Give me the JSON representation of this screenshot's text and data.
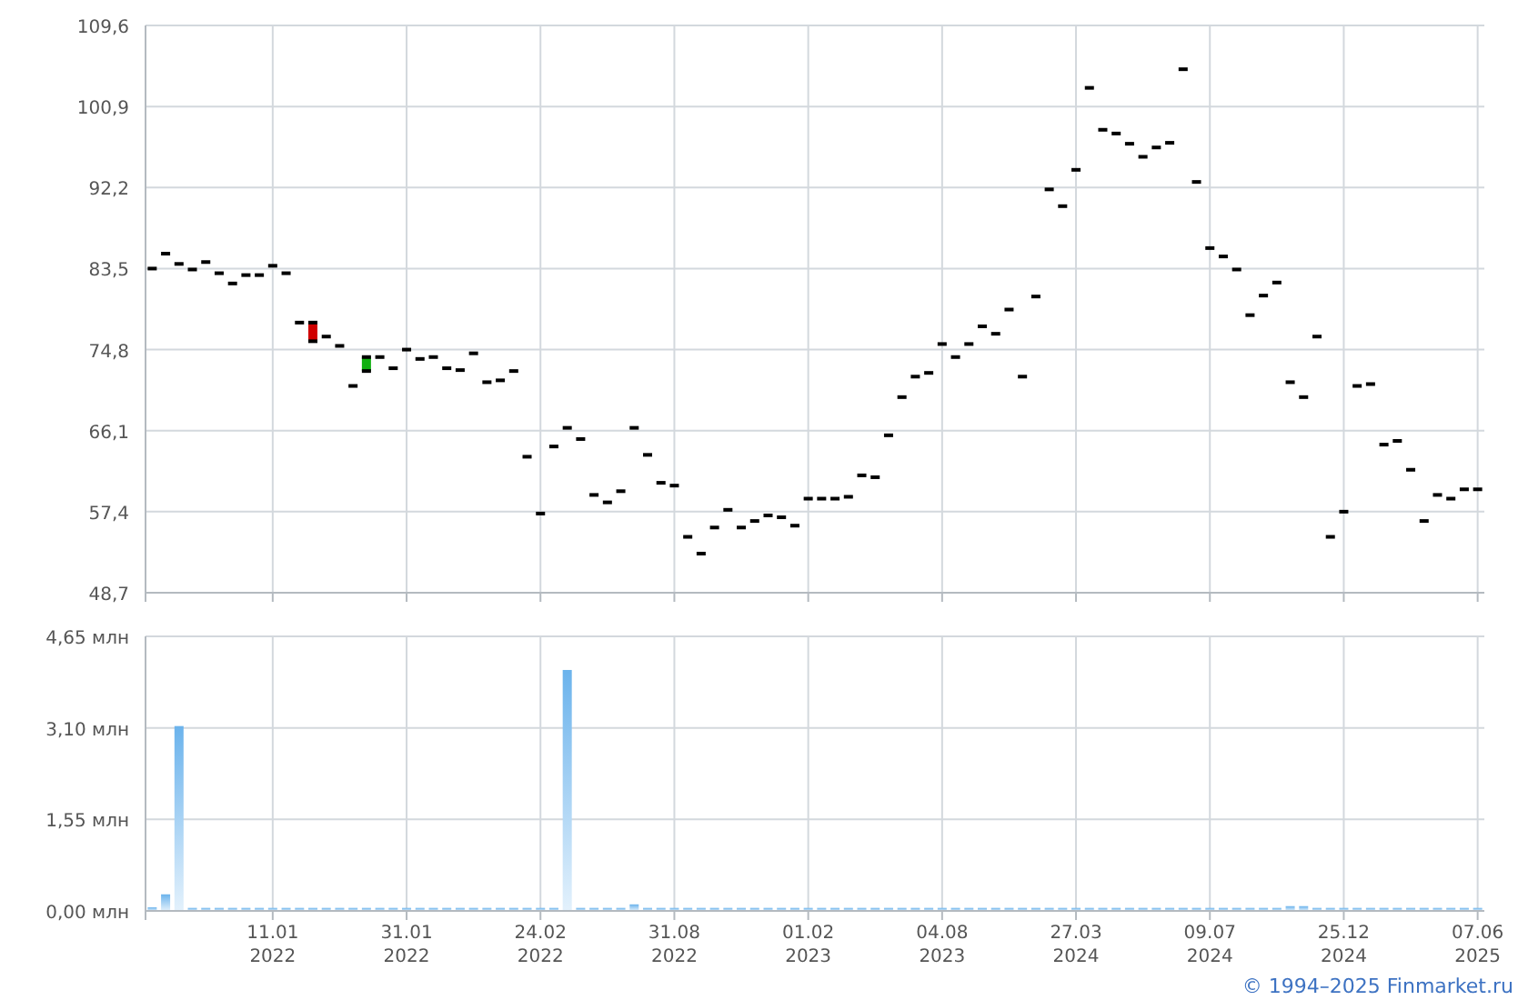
{
  "price_chart": {
    "chart_data": {
      "type": "scatter",
      "grid": true,
      "categories": [
        null,
        null,
        null,
        null,
        null,
        null,
        null,
        null,
        null,
        null,
        null,
        null,
        null,
        null,
        null,
        null,
        null,
        null,
        null,
        null,
        null,
        null,
        null,
        null,
        null,
        null,
        null,
        null,
        null,
        null,
        null,
        null,
        null,
        null,
        null,
        null,
        null,
        null,
        null,
        null,
        null,
        null,
        null,
        null,
        null,
        null,
        null,
        null,
        null,
        null,
        null,
        null,
        null,
        null,
        null,
        null,
        null,
        null,
        null,
        null,
        null,
        null,
        null,
        null,
        null,
        null,
        null,
        null,
        null,
        null,
        null,
        null,
        null,
        null,
        null,
        null,
        null,
        null,
        null,
        null,
        null,
        null,
        null,
        null,
        null,
        null,
        null,
        null,
        null,
        null,
        null,
        null,
        null,
        null,
        null,
        null,
        null,
        null,
        null,
        null
      ],
      "series": [
        {
          "color": "#000000",
          "values": [
            83.5,
            85.1,
            84.0,
            83.4,
            84.2,
            83.0,
            81.9,
            82.8,
            82.8,
            83.8,
            83.0,
            77.7,
            75.7,
            76.2,
            75.2,
            70.9,
            74.0,
            74.0,
            72.8,
            74.8,
            73.8,
            74.0,
            72.8,
            72.6,
            74.4,
            71.3,
            71.5,
            72.5,
            63.3,
            57.2,
            64.4,
            66.4,
            65.2,
            59.2,
            58.4,
            59.6,
            66.4,
            63.5,
            60.5,
            60.2,
            54.7,
            52.9,
            55.7,
            57.6,
            55.7,
            56.4,
            57.0,
            56.8,
            55.9,
            58.8,
            58.8,
            58.8,
            59.0,
            61.3,
            61.1,
            65.6,
            69.7,
            71.9,
            72.3,
            75.4,
            74.0,
            75.4,
            77.3,
            76.5,
            79.1,
            71.9,
            80.5,
            92.0,
            90.2,
            94.1,
            102.9,
            98.4,
            98.0,
            96.9,
            95.5,
            96.5,
            97.0,
            104.9,
            92.8,
            85.7,
            84.8,
            83.4,
            78.5,
            80.6,
            82.0,
            71.3,
            69.7,
            76.2,
            54.7,
            57.4,
            70.9,
            71.1,
            64.6,
            65.0,
            61.9,
            56.4,
            59.2,
            58.8,
            59.8,
            59.8
          ]
        },
        {
          "color": "#000000",
          "values": [
            null,
            null,
            null,
            null,
            null,
            null,
            null,
            null,
            null,
            null,
            null,
            null,
            77.7,
            null,
            null,
            null,
            72.5,
            null,
            null,
            null,
            null,
            null,
            null,
            null,
            null,
            null,
            null,
            null,
            null,
            null,
            null,
            null,
            null,
            null,
            null,
            null,
            null,
            null,
            null,
            null,
            null,
            null,
            null,
            null,
            null,
            null,
            null,
            null,
            null,
            null,
            null,
            null,
            null,
            null,
            null,
            null,
            null,
            null,
            null,
            null,
            null,
            null,
            null,
            null,
            null,
            null,
            null,
            null,
            null,
            null,
            null,
            null,
            null,
            null,
            null,
            null,
            null,
            null,
            null,
            null,
            null,
            null,
            null,
            null,
            null,
            null,
            null,
            null,
            null,
            null,
            null,
            null,
            null,
            null,
            null,
            null,
            null,
            null,
            null,
            null
          ]
        }
      ],
      "ylim": [
        48.7,
        109.6
      ],
      "yticks": [
        {
          "value": 48.7,
          "label": "48,7"
        },
        {
          "value": 57.4,
          "label": "57,4"
        },
        {
          "value": 66.1,
          "label": "66,1"
        },
        {
          "value": 74.8,
          "label": "74,8"
        },
        {
          "value": 83.5,
          "label": "83,5"
        },
        {
          "value": 92.2,
          "label": "92,2"
        },
        {
          "value": 100.9,
          "label": "100,9"
        },
        {
          "value": 109.6,
          "label": "109,6"
        }
      ]
    }
  },
  "volume_chart": {
    "chart_data": {
      "type": "bar",
      "grid": true,
      "categories": [
        null,
        null,
        null,
        null,
        null,
        null,
        null,
        null,
        null,
        "11.01\n2022",
        null,
        null,
        null,
        null,
        null,
        null,
        null,
        null,
        null,
        "31.01\n2022",
        null,
        null,
        null,
        null,
        null,
        null,
        null,
        null,
        null,
        "24.02\n2022",
        null,
        null,
        null,
        null,
        null,
        null,
        null,
        null,
        null,
        "31.08\n2022",
        null,
        null,
        null,
        null,
        null,
        null,
        null,
        null,
        null,
        "01.02\n2023",
        null,
        null,
        null,
        null,
        null,
        null,
        null,
        null,
        null,
        "04.08\n2023",
        null,
        null,
        null,
        null,
        null,
        null,
        null,
        null,
        null,
        "27.03\n2024",
        null,
        null,
        null,
        null,
        null,
        null,
        null,
        null,
        null,
        "09.07\n2024",
        null,
        null,
        null,
        null,
        null,
        null,
        null,
        null,
        null,
        "25.12\n2024",
        null,
        null,
        null,
        null,
        null,
        null,
        null,
        null,
        null,
        "07.06\n2025"
      ],
      "series": [
        {
          "color": "#6bb3ec",
          "values": [
            0.03,
            0.25,
            3.1,
            0.02,
            0.02,
            0.02,
            0.02,
            0.02,
            0.02,
            0.02,
            0.02,
            0.02,
            0.02,
            0.02,
            0.02,
            0.02,
            0.02,
            0.02,
            0.02,
            0.02,
            0.02,
            0.02,
            0.02,
            0.02,
            0.02,
            0.02,
            0.02,
            0.02,
            0.02,
            0.02,
            0.02,
            4.05,
            0.02,
            0.02,
            0.02,
            0.02,
            0.08,
            0.02,
            0.02,
            0.02,
            0.02,
            0.02,
            0.02,
            0.02,
            0.02,
            0.02,
            0.02,
            0.02,
            0.02,
            0.02,
            0.02,
            0.02,
            0.02,
            0.02,
            0.02,
            0.02,
            0.02,
            0.02,
            0.02,
            0.02,
            0.02,
            0.02,
            0.02,
            0.02,
            0.02,
            0.02,
            0.02,
            0.02,
            0.02,
            0.02,
            0.02,
            0.02,
            0.02,
            0.02,
            0.02,
            0.02,
            0.02,
            0.02,
            0.02,
            0.02,
            0.02,
            0.02,
            0.02,
            0.02,
            0.02,
            0.05,
            0.05,
            0.02,
            0.02,
            0.02,
            0.02,
            0.02,
            0.02,
            0.02,
            0.02,
            0.02,
            0.02,
            0.02,
            0.02,
            0.02
          ]
        }
      ],
      "ylim": [
        0,
        4.65
      ],
      "yticks": [
        {
          "value": 0,
          "label": "0,00 млн"
        },
        {
          "value": 1.55,
          "label": "1,55 млн"
        },
        {
          "value": 3.1,
          "label": "3,10 млн"
        },
        {
          "value": 4.65,
          "label": "4,65 млн"
        }
      ]
    }
  },
  "footer": {
    "copyright": "© 1994–2025 Finmarket.ru"
  }
}
